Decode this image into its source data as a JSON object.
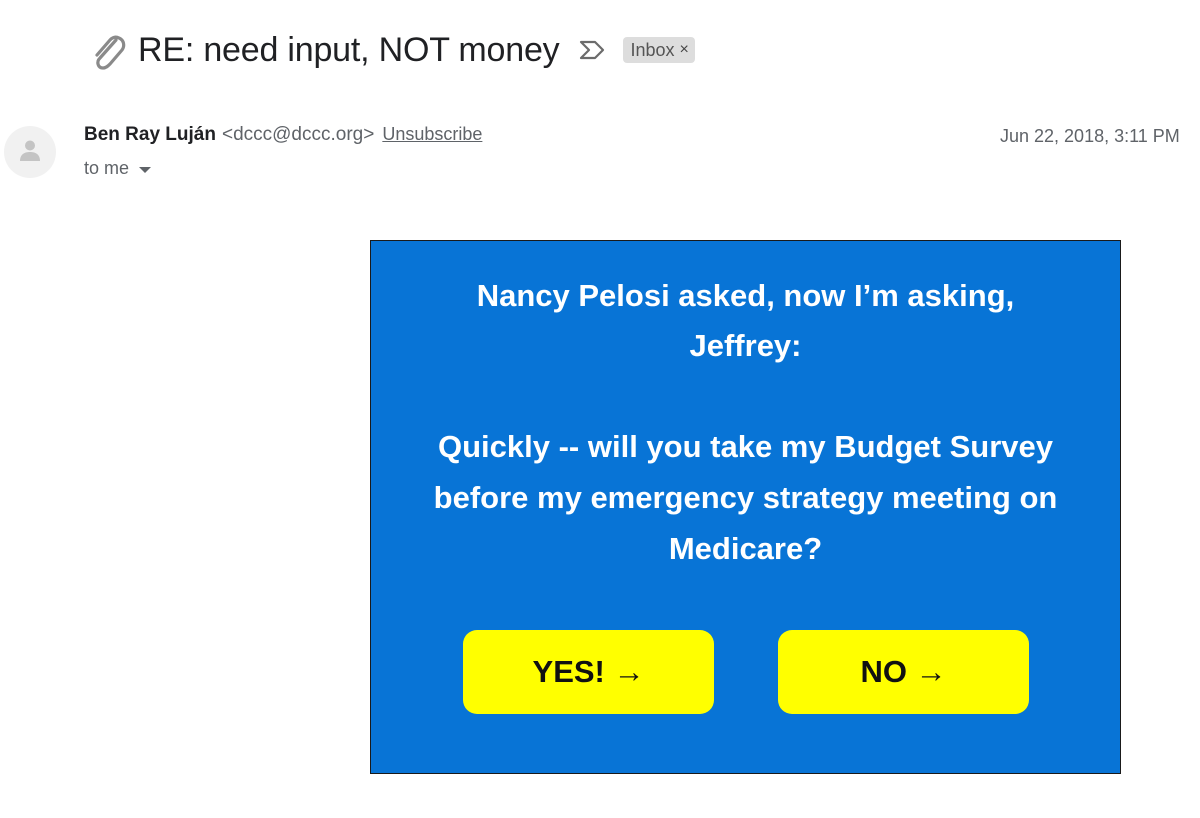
{
  "email": {
    "subject": "RE: need input, NOT money",
    "label_chip": "Inbox",
    "label_remove_glyph": "×",
    "sender": {
      "name": "Ben Ray Luján",
      "email": "<dccc@dccc.org>",
      "unsubscribe": "Unsubscribe"
    },
    "date": "Jun 22, 2018, 3:11 PM",
    "recipient": "to me"
  },
  "card": {
    "heading_line1": "Nancy Pelosi asked, now I’m asking,",
    "heading_line2": "Jeffrey:",
    "body_line1": "Quickly -- will you take my Budget Survey",
    "body_line2": "before my emergency strategy meeting on",
    "body_line3": "Medicare?",
    "yes_label": "YES! →",
    "no_label": "NO →"
  },
  "icons": {
    "attachment": "paperclip-icon",
    "importance": "important-marker-icon",
    "avatar": "person-icon",
    "recipient_details": "caret-down-icon"
  },
  "colors": {
    "card_background": "#0874d6",
    "button_background": "#ffff00",
    "chip_background": "#dddddd"
  }
}
